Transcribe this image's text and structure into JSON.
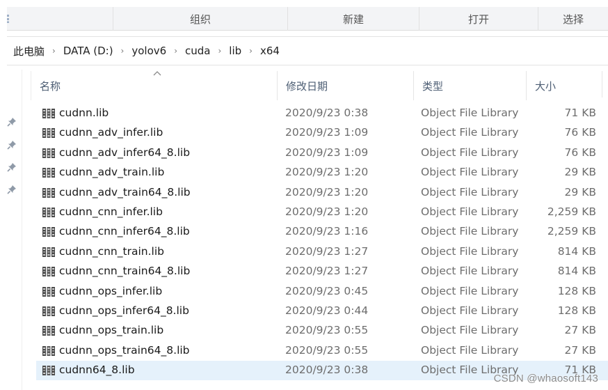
{
  "ribbon": {
    "groups": [
      {
        "label": "组织"
      },
      {
        "label": "新建"
      },
      {
        "label": "打开"
      },
      {
        "label": "选择"
      }
    ]
  },
  "address": {
    "crumbs": [
      "此电脑",
      "DATA (D:)",
      "yolov6",
      "cuda",
      "lib",
      "x64"
    ],
    "separator": "›"
  },
  "columns": {
    "name": "名称",
    "date": "修改日期",
    "type": "类型",
    "size": "大小",
    "sort_column": "name",
    "sort_direction": "ascending"
  },
  "nav": {
    "pinned_count": 4,
    "pin_icon": "pin-icon"
  },
  "files": [
    {
      "name": "cudnn.lib",
      "date": "2020/9/23 0:38",
      "type": "Object File Library",
      "size": "71 KB",
      "icon": "library-file-icon"
    },
    {
      "name": "cudnn_adv_infer.lib",
      "date": "2020/9/23 1:09",
      "type": "Object File Library",
      "size": "76 KB",
      "icon": "library-file-icon"
    },
    {
      "name": "cudnn_adv_infer64_8.lib",
      "date": "2020/9/23 1:09",
      "type": "Object File Library",
      "size": "76 KB",
      "icon": "library-file-icon"
    },
    {
      "name": "cudnn_adv_train.lib",
      "date": "2020/9/23 1:20",
      "type": "Object File Library",
      "size": "29 KB",
      "icon": "library-file-icon"
    },
    {
      "name": "cudnn_adv_train64_8.lib",
      "date": "2020/9/23 1:20",
      "type": "Object File Library",
      "size": "29 KB",
      "icon": "library-file-icon"
    },
    {
      "name": "cudnn_cnn_infer.lib",
      "date": "2020/9/23 1:20",
      "type": "Object File Library",
      "size": "2,259 KB",
      "icon": "library-file-icon"
    },
    {
      "name": "cudnn_cnn_infer64_8.lib",
      "date": "2020/9/23 1:16",
      "type": "Object File Library",
      "size": "2,259 KB",
      "icon": "library-file-icon"
    },
    {
      "name": "cudnn_cnn_train.lib",
      "date": "2020/9/23 1:27",
      "type": "Object File Library",
      "size": "814 KB",
      "icon": "library-file-icon"
    },
    {
      "name": "cudnn_cnn_train64_8.lib",
      "date": "2020/9/23 1:27",
      "type": "Object File Library",
      "size": "814 KB",
      "icon": "library-file-icon"
    },
    {
      "name": "cudnn_ops_infer.lib",
      "date": "2020/9/23 0:45",
      "type": "Object File Library",
      "size": "128 KB",
      "icon": "library-file-icon"
    },
    {
      "name": "cudnn_ops_infer64_8.lib",
      "date": "2020/9/23 0:44",
      "type": "Object File Library",
      "size": "128 KB",
      "icon": "library-file-icon"
    },
    {
      "name": "cudnn_ops_train.lib",
      "date": "2020/9/23 0:55",
      "type": "Object File Library",
      "size": "27 KB",
      "icon": "library-file-icon"
    },
    {
      "name": "cudnn_ops_train64_8.lib",
      "date": "2020/9/23 0:55",
      "type": "Object File Library",
      "size": "27 KB",
      "icon": "library-file-icon"
    },
    {
      "name": "cudnn64_8.lib",
      "date": "2020/9/23 0:38",
      "type": "Object File Library",
      "size": "71 KB",
      "icon": "library-file-icon",
      "selected": true
    }
  ],
  "watermark": "CSDN @whaosoft143",
  "colors": {
    "selection": "#e5f1fb",
    "header_text": "#4c5d73",
    "secondary_text": "#6d6d6d",
    "ribbon_bg": "#f3f4f6"
  }
}
